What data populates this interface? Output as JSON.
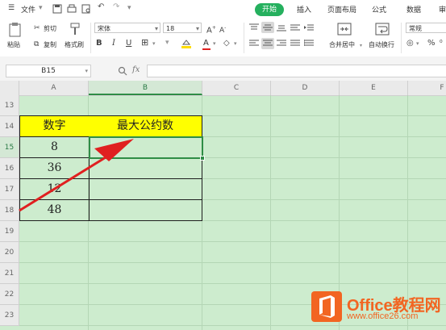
{
  "menubar": {
    "file_label": "文件",
    "tabs": [
      {
        "label": "开始"
      },
      {
        "label": "插入"
      },
      {
        "label": "页面布局"
      },
      {
        "label": "公式"
      },
      {
        "label": "数据"
      },
      {
        "label": "审阅"
      }
    ]
  },
  "ribbon": {
    "paste": "粘贴",
    "cut": "剪切",
    "copy": "复制",
    "format_painter": "格式刷",
    "font_name": "宋体",
    "font_size": "18",
    "merge_center": "合并居中",
    "wrap_text": "自动换行",
    "number_format": "常规",
    "percent": "%"
  },
  "formula_bar": {
    "name_box": "B15",
    "fx": "fx",
    "value": ""
  },
  "sheet": {
    "columns": [
      "A",
      "B",
      "C",
      "D",
      "E",
      "F"
    ],
    "rows": [
      "13",
      "14",
      "15",
      "16",
      "17",
      "18",
      "19",
      "20",
      "21",
      "22",
      "23"
    ],
    "selected_cell": "B15",
    "header_a": "数字",
    "header_b": "最大公约数",
    "values": [
      "8",
      "36",
      "12",
      "48"
    ]
  },
  "watermark": {
    "brand": "Office教程网",
    "url": "www.office26.com"
  },
  "colors": {
    "accent": "#25b05e",
    "grid_bg": "#cdecce",
    "header_fill": "#ffff00",
    "arrow": "#e02020"
  }
}
